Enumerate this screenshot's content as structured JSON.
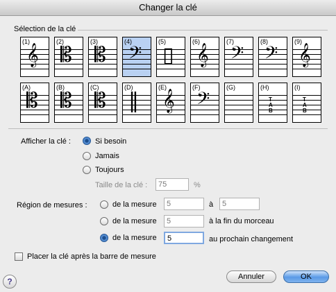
{
  "window": {
    "title": "Changer la clé"
  },
  "selection": {
    "label": "Sélection de la clé",
    "clefs": [
      {
        "label": "(1)",
        "glyph": "𝄞",
        "selected": false
      },
      {
        "label": "(2)",
        "glyph": "𝄡",
        "selected": false
      },
      {
        "label": "(3)",
        "glyph": "𝄡",
        "selected": false
      },
      {
        "label": "(4)",
        "glyph": "𝄢",
        "selected": true
      },
      {
        "label": "(5)",
        "glyph": "▯",
        "selected": false
      },
      {
        "label": "(6)",
        "glyph": "𝄞",
        "selected": false
      },
      {
        "label": "(7)",
        "glyph": "𝄢",
        "selected": false
      },
      {
        "label": "(8)",
        "glyph": "𝄢",
        "selected": false
      },
      {
        "label": "(9)",
        "glyph": "𝄞",
        "selected": false
      },
      {
        "label": "(A)",
        "glyph": "𝄡",
        "selected": false
      },
      {
        "label": "(B)",
        "glyph": "𝄡",
        "selected": false
      },
      {
        "label": "(C)",
        "glyph": "𝄡",
        "selected": false
      },
      {
        "label": "(D)",
        "glyph": "‖",
        "selected": false
      },
      {
        "label": "(E)",
        "glyph": "𝄞",
        "selected": false
      },
      {
        "label": "(F)",
        "glyph": "𝄢",
        "selected": false
      },
      {
        "label": "(G)",
        "glyph": "",
        "selected": false
      },
      {
        "label": "(H)",
        "glyph": "TAB",
        "selected": false
      },
      {
        "label": "(I)",
        "glyph": "TAB",
        "selected": false
      }
    ]
  },
  "display": {
    "label": "Afficher la clé :",
    "options": [
      "Si besoin",
      "Jamais",
      "Toujours"
    ],
    "selected_index": 0,
    "size_label": "Taille de la clé :",
    "size_value": "75",
    "size_unit": "%"
  },
  "region": {
    "label": "Région de mesures :",
    "option1": {
      "text": "de la mesure",
      "from": "5",
      "to_label": "à",
      "to": "5"
    },
    "option2": {
      "text": "de la mesure",
      "from": "5",
      "suffix": "à la fin du morceau"
    },
    "option3": {
      "text": "de la mesure",
      "from": "5",
      "suffix": "au prochain changement"
    },
    "selected_index": 2
  },
  "options": {
    "place_after_barline": "Placer la clé après la barre de mesure"
  },
  "buttons": {
    "cancel": "Annuler",
    "ok": "OK",
    "help": "?"
  }
}
